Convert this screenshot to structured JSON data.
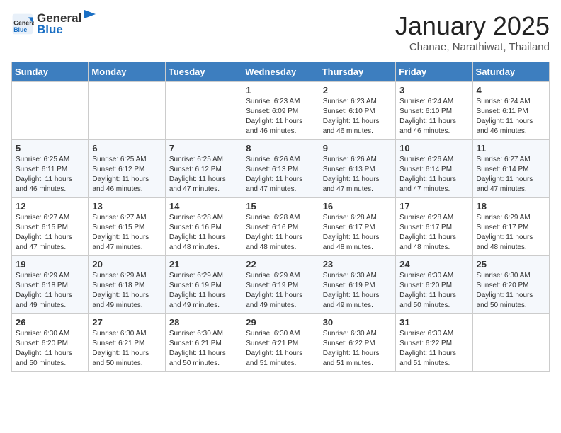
{
  "header": {
    "logo_line1": "General",
    "logo_line2": "Blue",
    "month": "January 2025",
    "location": "Chanae, Narathiwat, Thailand"
  },
  "weekdays": [
    "Sunday",
    "Monday",
    "Tuesday",
    "Wednesday",
    "Thursday",
    "Friday",
    "Saturday"
  ],
  "weeks": [
    [
      {
        "day": "",
        "info": ""
      },
      {
        "day": "",
        "info": ""
      },
      {
        "day": "",
        "info": ""
      },
      {
        "day": "1",
        "info": "Sunrise: 6:23 AM\nSunset: 6:09 PM\nDaylight: 11 hours and 46 minutes."
      },
      {
        "day": "2",
        "info": "Sunrise: 6:23 AM\nSunset: 6:10 PM\nDaylight: 11 hours and 46 minutes."
      },
      {
        "day": "3",
        "info": "Sunrise: 6:24 AM\nSunset: 6:10 PM\nDaylight: 11 hours and 46 minutes."
      },
      {
        "day": "4",
        "info": "Sunrise: 6:24 AM\nSunset: 6:11 PM\nDaylight: 11 hours and 46 minutes."
      }
    ],
    [
      {
        "day": "5",
        "info": "Sunrise: 6:25 AM\nSunset: 6:11 PM\nDaylight: 11 hours and 46 minutes."
      },
      {
        "day": "6",
        "info": "Sunrise: 6:25 AM\nSunset: 6:12 PM\nDaylight: 11 hours and 46 minutes."
      },
      {
        "day": "7",
        "info": "Sunrise: 6:25 AM\nSunset: 6:12 PM\nDaylight: 11 hours and 47 minutes."
      },
      {
        "day": "8",
        "info": "Sunrise: 6:26 AM\nSunset: 6:13 PM\nDaylight: 11 hours and 47 minutes."
      },
      {
        "day": "9",
        "info": "Sunrise: 6:26 AM\nSunset: 6:13 PM\nDaylight: 11 hours and 47 minutes."
      },
      {
        "day": "10",
        "info": "Sunrise: 6:26 AM\nSunset: 6:14 PM\nDaylight: 11 hours and 47 minutes."
      },
      {
        "day": "11",
        "info": "Sunrise: 6:27 AM\nSunset: 6:14 PM\nDaylight: 11 hours and 47 minutes."
      }
    ],
    [
      {
        "day": "12",
        "info": "Sunrise: 6:27 AM\nSunset: 6:15 PM\nDaylight: 11 hours and 47 minutes."
      },
      {
        "day": "13",
        "info": "Sunrise: 6:27 AM\nSunset: 6:15 PM\nDaylight: 11 hours and 47 minutes."
      },
      {
        "day": "14",
        "info": "Sunrise: 6:28 AM\nSunset: 6:16 PM\nDaylight: 11 hours and 48 minutes."
      },
      {
        "day": "15",
        "info": "Sunrise: 6:28 AM\nSunset: 6:16 PM\nDaylight: 11 hours and 48 minutes."
      },
      {
        "day": "16",
        "info": "Sunrise: 6:28 AM\nSunset: 6:17 PM\nDaylight: 11 hours and 48 minutes."
      },
      {
        "day": "17",
        "info": "Sunrise: 6:28 AM\nSunset: 6:17 PM\nDaylight: 11 hours and 48 minutes."
      },
      {
        "day": "18",
        "info": "Sunrise: 6:29 AM\nSunset: 6:17 PM\nDaylight: 11 hours and 48 minutes."
      }
    ],
    [
      {
        "day": "19",
        "info": "Sunrise: 6:29 AM\nSunset: 6:18 PM\nDaylight: 11 hours and 49 minutes."
      },
      {
        "day": "20",
        "info": "Sunrise: 6:29 AM\nSunset: 6:18 PM\nDaylight: 11 hours and 49 minutes."
      },
      {
        "day": "21",
        "info": "Sunrise: 6:29 AM\nSunset: 6:19 PM\nDaylight: 11 hours and 49 minutes."
      },
      {
        "day": "22",
        "info": "Sunrise: 6:29 AM\nSunset: 6:19 PM\nDaylight: 11 hours and 49 minutes."
      },
      {
        "day": "23",
        "info": "Sunrise: 6:30 AM\nSunset: 6:19 PM\nDaylight: 11 hours and 49 minutes."
      },
      {
        "day": "24",
        "info": "Sunrise: 6:30 AM\nSunset: 6:20 PM\nDaylight: 11 hours and 50 minutes."
      },
      {
        "day": "25",
        "info": "Sunrise: 6:30 AM\nSunset: 6:20 PM\nDaylight: 11 hours and 50 minutes."
      }
    ],
    [
      {
        "day": "26",
        "info": "Sunrise: 6:30 AM\nSunset: 6:20 PM\nDaylight: 11 hours and 50 minutes."
      },
      {
        "day": "27",
        "info": "Sunrise: 6:30 AM\nSunset: 6:21 PM\nDaylight: 11 hours and 50 minutes."
      },
      {
        "day": "28",
        "info": "Sunrise: 6:30 AM\nSunset: 6:21 PM\nDaylight: 11 hours and 50 minutes."
      },
      {
        "day": "29",
        "info": "Sunrise: 6:30 AM\nSunset: 6:21 PM\nDaylight: 11 hours and 51 minutes."
      },
      {
        "day": "30",
        "info": "Sunrise: 6:30 AM\nSunset: 6:22 PM\nDaylight: 11 hours and 51 minutes."
      },
      {
        "day": "31",
        "info": "Sunrise: 6:30 AM\nSunset: 6:22 PM\nDaylight: 11 hours and 51 minutes."
      },
      {
        "day": "",
        "info": ""
      }
    ]
  ]
}
